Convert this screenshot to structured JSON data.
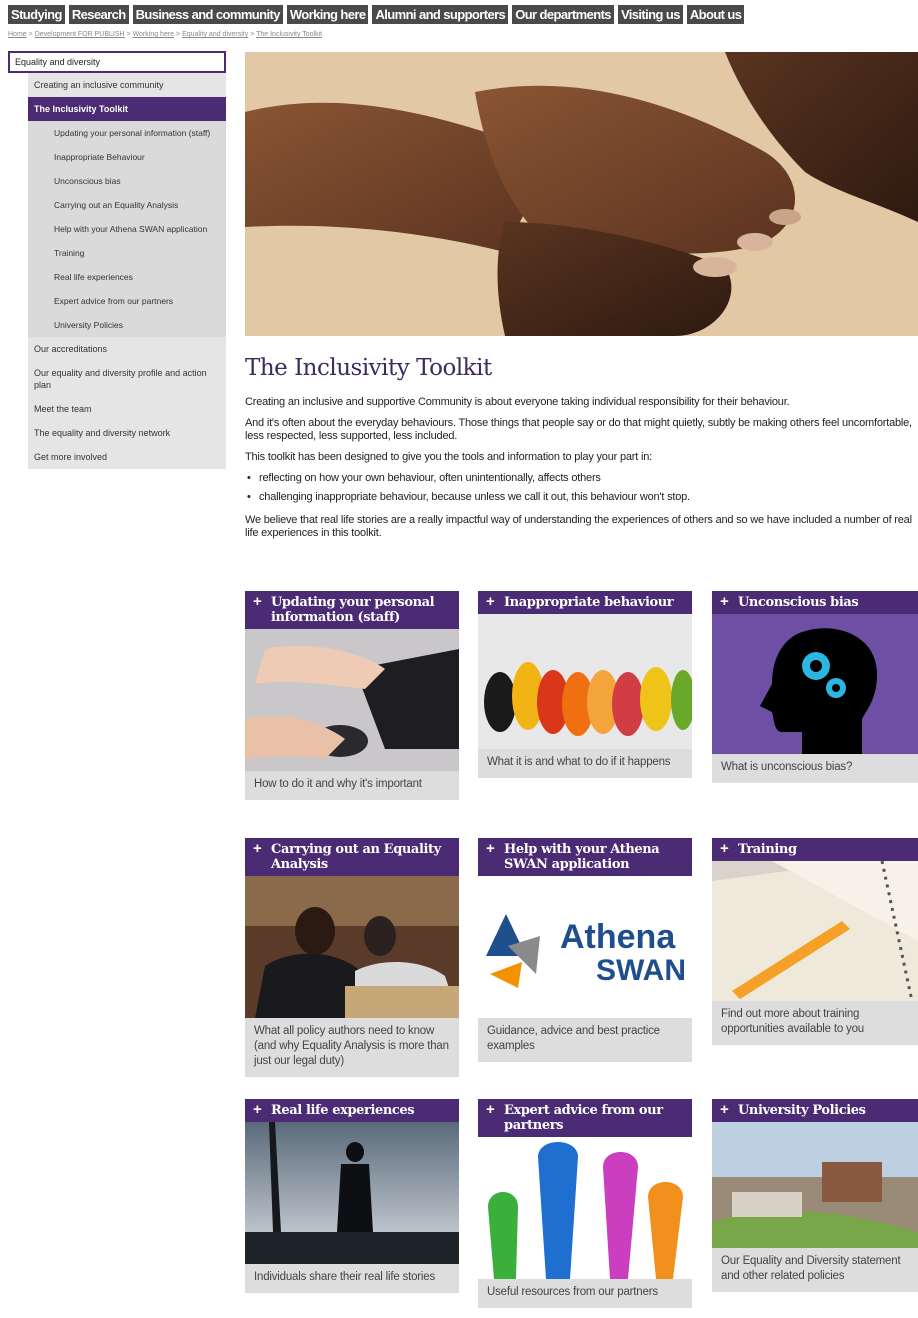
{
  "topnav": [
    "Studying",
    "Research",
    "Business and community",
    "Working here",
    "Alumni and supporters",
    "Our departments",
    "Visiting us",
    "About us"
  ],
  "breadcrumb": {
    "items": [
      "Home",
      "Development FOR PUBLISH",
      "Working here",
      "Equality and diversity",
      "The Inclusivity Toolkit"
    ],
    "sep": ">"
  },
  "sidebar": {
    "head": "Equality and diversity",
    "level1_top": "Creating an inclusive community",
    "active": "The Inclusivity Toolkit",
    "sub": [
      "Updating your personal information (staff)",
      "Inappropriate Behaviour",
      "Unconscious bias",
      "Carrying out an Equality Analysis",
      "Help with your Athena SWAN application",
      "Training",
      "Real life experiences",
      "Expert advice from our partners",
      "University Policies"
    ],
    "rest": [
      "Our accreditations",
      "Our equality and diversity profile and action plan",
      "Meet the team",
      "The equality and diversity network",
      "Get more involved"
    ]
  },
  "page": {
    "title": "The Inclusivity Toolkit",
    "p1": "Creating an inclusive and supportive Community is about everyone taking individual responsibility for their behaviour.",
    "p2": "And it's often about the everyday behaviours. Those things that people say or do that might quietly, subtly be making others feel uncomfortable, less respected, less supported, less included.",
    "p3": "This toolkit has been designed to give you the tools and information to play your part in:",
    "bullets": [
      "reflecting on how your own behaviour, often unintentionally, affects others",
      "challenging inappropriate behaviour, because unless we call it out, this behaviour won't stop."
    ],
    "p4": "We believe that real life stories are a really impactful way of understanding the experiences of others and so we have included a number of real life experiences in this toolkit."
  },
  "tiles": [
    {
      "title": "Updating your personal information (staff)",
      "caption": "How to do it and why it's important"
    },
    {
      "title": "Inappropriate behaviour",
      "caption": "What it is and what to do if it happens"
    },
    {
      "title": "Unconscious bias",
      "caption": "What is unconscious bias?"
    },
    {
      "title": "Carrying out an Equality Analysis",
      "caption": "What all policy authors need to know (and why Equality Analysis is more than just our legal duty)"
    },
    {
      "title": "Help with your Athena SWAN application",
      "caption": "Guidance, advice and best practice examples"
    },
    {
      "title": "Training",
      "caption": "Find out more about training opportunities available to you"
    },
    {
      "title": "Real life experiences",
      "caption": "Individuals share their real life stories"
    },
    {
      "title": "Expert advice from our partners",
      "caption": "Useful resources from our partners"
    },
    {
      "title": "University Policies",
      "caption": "Our Equality and Diversity statement and other related policies"
    }
  ],
  "plus_symbol": "+",
  "athena_logo": {
    "line1": "Athena",
    "line2": "SWAN"
  },
  "colors": {
    "brand_purple": "#4b2b73",
    "nav_grey": "#4a4a4a",
    "athena_blue": "#1f4e8c",
    "athena_orange": "#f39200"
  }
}
